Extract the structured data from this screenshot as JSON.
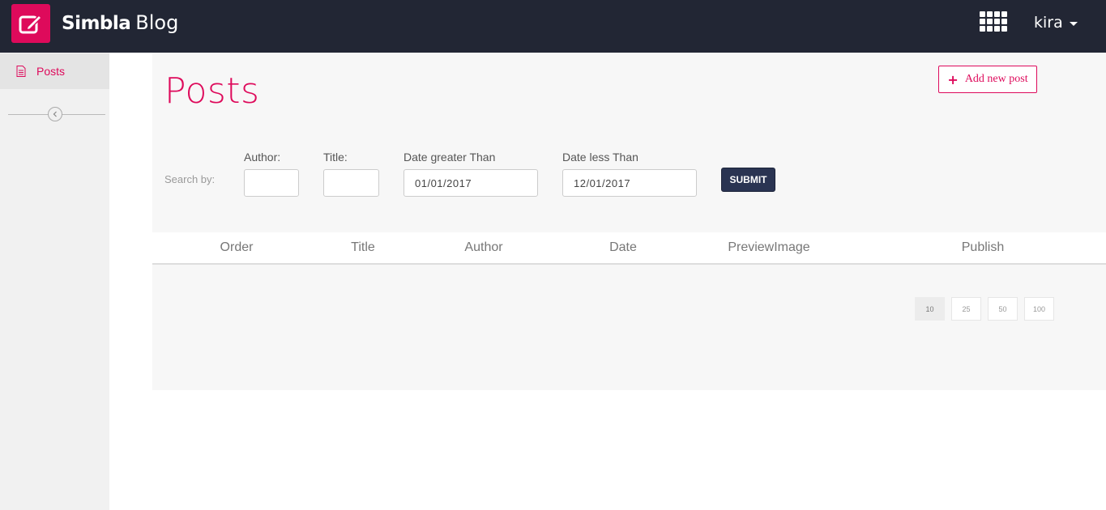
{
  "header": {
    "brand_primary": "Simbla",
    "brand_secondary": "Blog",
    "user_name": "kira",
    "icons": {
      "logo": "edit-icon",
      "apps": "apps-grid-icon",
      "user_caret": "caret-down-icon"
    },
    "colors": {
      "bar": "#222634",
      "logo": "#de0a5b"
    }
  },
  "sidebar": {
    "items": [
      {
        "label": "Posts",
        "icon": "document-icon",
        "active": true
      }
    ],
    "collapse_icon": "chevron-left-icon"
  },
  "main": {
    "title": "Posts",
    "add_button_label": "Add new post",
    "accent_color": "#de0a5b"
  },
  "search": {
    "label": "Search by:",
    "fields": [
      {
        "label": "Author:",
        "value": ""
      },
      {
        "label": "Title:",
        "value": ""
      },
      {
        "label": "Date greater Than",
        "value": "01/01/2017"
      },
      {
        "label": "Date less Than",
        "value": "12/01/2017"
      }
    ],
    "submit_label": "SUBMIT"
  },
  "table": {
    "columns": [
      "Order",
      "Title",
      "Author",
      "Date",
      "PreviewImage",
      "Publish"
    ],
    "rows": []
  },
  "pagination": {
    "page_sizes": [
      "10",
      "25",
      "50",
      "100"
    ],
    "selected": "10"
  }
}
